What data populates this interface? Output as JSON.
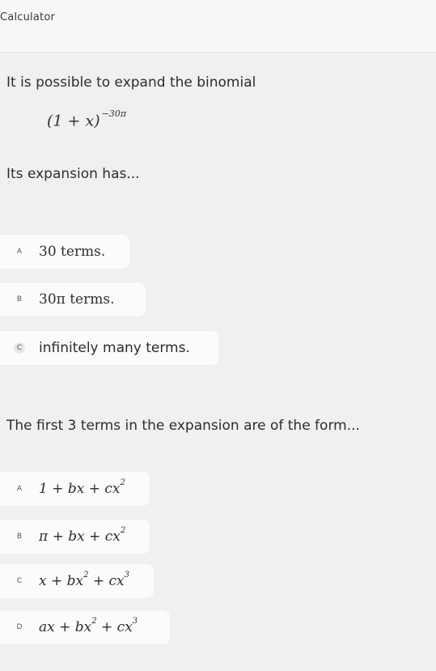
{
  "app": {
    "title": "Calculator"
  },
  "question1": {
    "prompt": "It is possible to expand the binomial",
    "formula_base": "(1 + x)",
    "formula_exponent": "−30π",
    "subprompt": "Its expansion has...",
    "options": [
      {
        "letter": "A",
        "text": "30 terms."
      },
      {
        "letter": "B",
        "text": "30π terms."
      },
      {
        "letter": "C",
        "text": "infinitely many terms."
      }
    ]
  },
  "question2": {
    "prompt": "The first 3 terms in the expansion are of the form...",
    "options": [
      {
        "letter": "A",
        "parts": [
          "1 + bx + cx",
          "2",
          ""
        ]
      },
      {
        "letter": "B",
        "parts": [
          "π + bx + cx",
          "2",
          ""
        ]
      },
      {
        "letter": "C",
        "parts": [
          "x + bx",
          "2",
          " + cx",
          "3"
        ]
      },
      {
        "letter": "D",
        "parts": [
          "ax + bx",
          "2",
          " + cx",
          "3"
        ]
      }
    ]
  }
}
